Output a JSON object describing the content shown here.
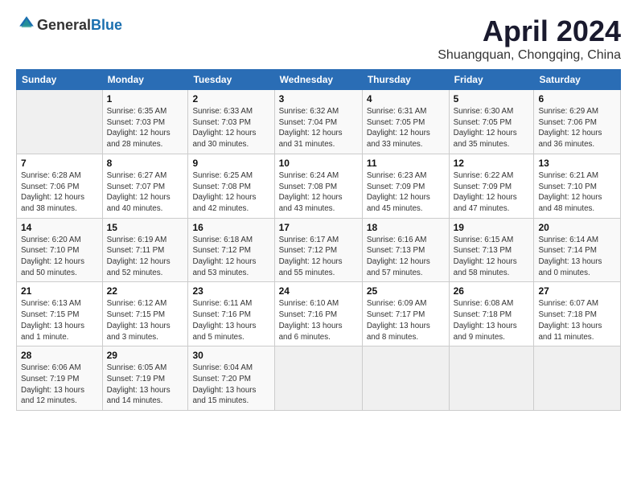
{
  "header": {
    "logo_line1": "General",
    "logo_line2": "Blue",
    "month_title": "April 2024",
    "location": "Shuangquan, Chongqing, China"
  },
  "days_of_week": [
    "Sunday",
    "Monday",
    "Tuesday",
    "Wednesday",
    "Thursday",
    "Friday",
    "Saturday"
  ],
  "weeks": [
    [
      {
        "day": "",
        "info": ""
      },
      {
        "day": "1",
        "info": "Sunrise: 6:35 AM\nSunset: 7:03 PM\nDaylight: 12 hours\nand 28 minutes."
      },
      {
        "day": "2",
        "info": "Sunrise: 6:33 AM\nSunset: 7:03 PM\nDaylight: 12 hours\nand 30 minutes."
      },
      {
        "day": "3",
        "info": "Sunrise: 6:32 AM\nSunset: 7:04 PM\nDaylight: 12 hours\nand 31 minutes."
      },
      {
        "day": "4",
        "info": "Sunrise: 6:31 AM\nSunset: 7:05 PM\nDaylight: 12 hours\nand 33 minutes."
      },
      {
        "day": "5",
        "info": "Sunrise: 6:30 AM\nSunset: 7:05 PM\nDaylight: 12 hours\nand 35 minutes."
      },
      {
        "day": "6",
        "info": "Sunrise: 6:29 AM\nSunset: 7:06 PM\nDaylight: 12 hours\nand 36 minutes."
      }
    ],
    [
      {
        "day": "7",
        "info": "Sunrise: 6:28 AM\nSunset: 7:06 PM\nDaylight: 12 hours\nand 38 minutes."
      },
      {
        "day": "8",
        "info": "Sunrise: 6:27 AM\nSunset: 7:07 PM\nDaylight: 12 hours\nand 40 minutes."
      },
      {
        "day": "9",
        "info": "Sunrise: 6:25 AM\nSunset: 7:08 PM\nDaylight: 12 hours\nand 42 minutes."
      },
      {
        "day": "10",
        "info": "Sunrise: 6:24 AM\nSunset: 7:08 PM\nDaylight: 12 hours\nand 43 minutes."
      },
      {
        "day": "11",
        "info": "Sunrise: 6:23 AM\nSunset: 7:09 PM\nDaylight: 12 hours\nand 45 minutes."
      },
      {
        "day": "12",
        "info": "Sunrise: 6:22 AM\nSunset: 7:09 PM\nDaylight: 12 hours\nand 47 minutes."
      },
      {
        "day": "13",
        "info": "Sunrise: 6:21 AM\nSunset: 7:10 PM\nDaylight: 12 hours\nand 48 minutes."
      }
    ],
    [
      {
        "day": "14",
        "info": "Sunrise: 6:20 AM\nSunset: 7:10 PM\nDaylight: 12 hours\nand 50 minutes."
      },
      {
        "day": "15",
        "info": "Sunrise: 6:19 AM\nSunset: 7:11 PM\nDaylight: 12 hours\nand 52 minutes."
      },
      {
        "day": "16",
        "info": "Sunrise: 6:18 AM\nSunset: 7:12 PM\nDaylight: 12 hours\nand 53 minutes."
      },
      {
        "day": "17",
        "info": "Sunrise: 6:17 AM\nSunset: 7:12 PM\nDaylight: 12 hours\nand 55 minutes."
      },
      {
        "day": "18",
        "info": "Sunrise: 6:16 AM\nSunset: 7:13 PM\nDaylight: 12 hours\nand 57 minutes."
      },
      {
        "day": "19",
        "info": "Sunrise: 6:15 AM\nSunset: 7:13 PM\nDaylight: 12 hours\nand 58 minutes."
      },
      {
        "day": "20",
        "info": "Sunrise: 6:14 AM\nSunset: 7:14 PM\nDaylight: 13 hours\nand 0 minutes."
      }
    ],
    [
      {
        "day": "21",
        "info": "Sunrise: 6:13 AM\nSunset: 7:15 PM\nDaylight: 13 hours\nand 1 minute."
      },
      {
        "day": "22",
        "info": "Sunrise: 6:12 AM\nSunset: 7:15 PM\nDaylight: 13 hours\nand 3 minutes."
      },
      {
        "day": "23",
        "info": "Sunrise: 6:11 AM\nSunset: 7:16 PM\nDaylight: 13 hours\nand 5 minutes."
      },
      {
        "day": "24",
        "info": "Sunrise: 6:10 AM\nSunset: 7:16 PM\nDaylight: 13 hours\nand 6 minutes."
      },
      {
        "day": "25",
        "info": "Sunrise: 6:09 AM\nSunset: 7:17 PM\nDaylight: 13 hours\nand 8 minutes."
      },
      {
        "day": "26",
        "info": "Sunrise: 6:08 AM\nSunset: 7:18 PM\nDaylight: 13 hours\nand 9 minutes."
      },
      {
        "day": "27",
        "info": "Sunrise: 6:07 AM\nSunset: 7:18 PM\nDaylight: 13 hours\nand 11 minutes."
      }
    ],
    [
      {
        "day": "28",
        "info": "Sunrise: 6:06 AM\nSunset: 7:19 PM\nDaylight: 13 hours\nand 12 minutes."
      },
      {
        "day": "29",
        "info": "Sunrise: 6:05 AM\nSunset: 7:19 PM\nDaylight: 13 hours\nand 14 minutes."
      },
      {
        "day": "30",
        "info": "Sunrise: 6:04 AM\nSunset: 7:20 PM\nDaylight: 13 hours\nand 15 minutes."
      },
      {
        "day": "",
        "info": ""
      },
      {
        "day": "",
        "info": ""
      },
      {
        "day": "",
        "info": ""
      },
      {
        "day": "",
        "info": ""
      }
    ]
  ]
}
